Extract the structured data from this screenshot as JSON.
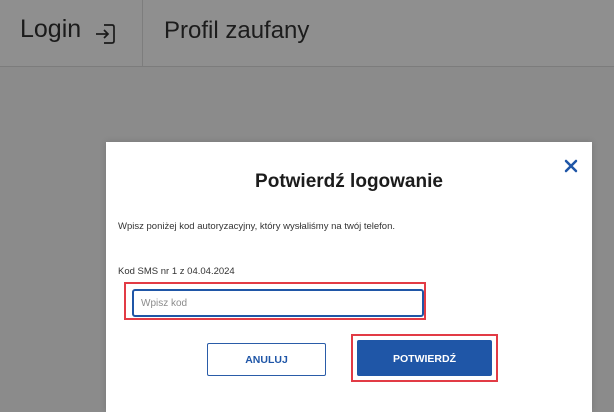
{
  "header": {
    "login_label": "Login",
    "profile_label": "Profil zaufany"
  },
  "modal": {
    "title": "Potwierdź logowanie",
    "instruction": "Wpisz poniżej kod autoryzacyjny, który wysłaliśmy na twój telefon.",
    "sms_label": "Kod SMS nr 1 z 04.04.2024",
    "code_placeholder": "Wpisz kod",
    "cancel_label": "ANULUJ",
    "confirm_label": "POTWIERDŹ"
  },
  "colors": {
    "primary_blue": "#1f56a7",
    "highlight_red": "#e23b45",
    "overlay_gray": "#8b8b8b"
  },
  "icons": {
    "login": "login-icon",
    "close": "close-icon"
  }
}
